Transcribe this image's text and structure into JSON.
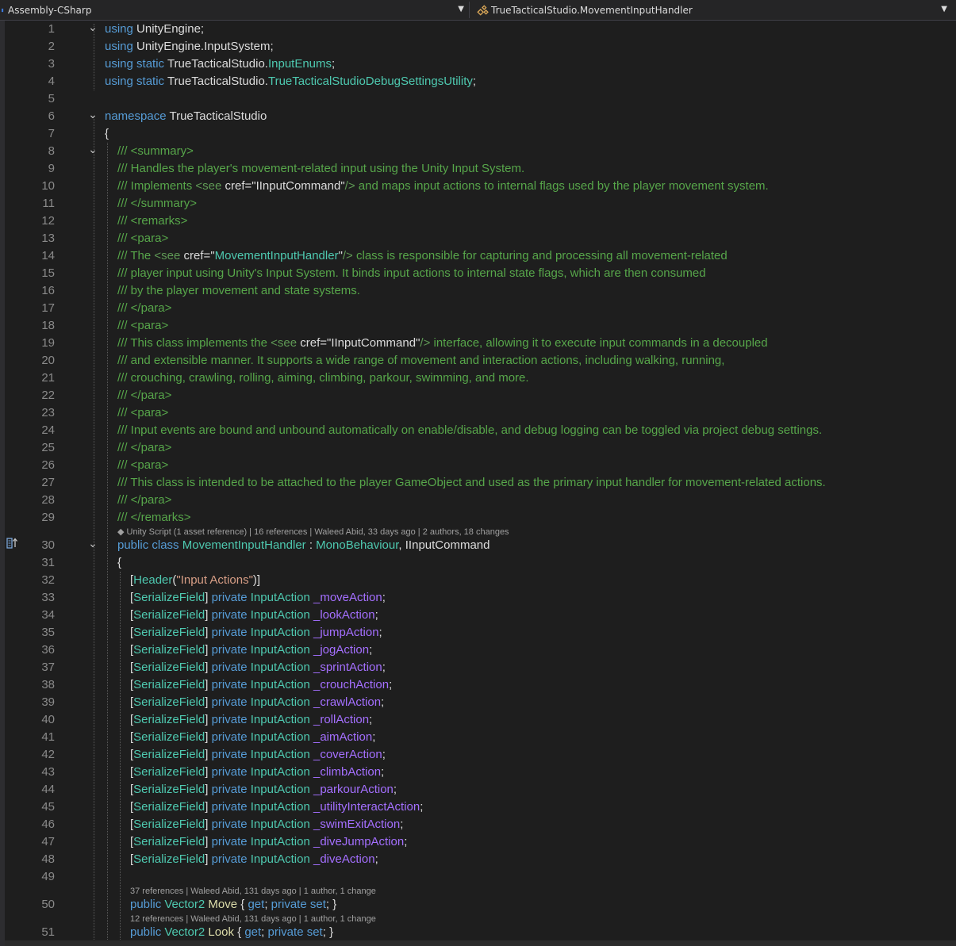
{
  "navbar": {
    "project": "Assembly-CSharp",
    "type_path": "TrueTacticalStudio.MovementInputHandler"
  },
  "colors": {
    "background": "#1e1e1e",
    "keyword": "#569cd6",
    "type": "#4ec9b0",
    "comment": "#57a64a",
    "string": "#d69d85",
    "field": "#a46fff",
    "text": "#dcdcdc",
    "line_number": "#8a8a8a"
  },
  "lines": [
    {
      "n": "1",
      "t": "using UnityEngine;"
    },
    {
      "n": "2",
      "t": "using UnityEngine.InputSystem;"
    },
    {
      "n": "3",
      "t": "using static TrueTacticalStudio.InputEnums;"
    },
    {
      "n": "4",
      "t": "using static TrueTacticalStudio.TrueTacticalStudioDebugSettingsUtility;"
    },
    {
      "n": "5",
      "t": ""
    },
    {
      "n": "6",
      "t": "namespace TrueTacticalStudio"
    },
    {
      "n": "7",
      "t": "{"
    },
    {
      "n": "8",
      "t": "/// <summary>"
    },
    {
      "n": "9",
      "t": "/// Handles the player's movement-related input using the Unity Input System."
    },
    {
      "n": "10",
      "t": "/// Implements <see cref=\"IInputCommand\"/> and maps input actions to internal flags used by the player movement system."
    },
    {
      "n": "11",
      "t": "/// </summary>"
    },
    {
      "n": "12",
      "t": "/// <remarks>"
    },
    {
      "n": "13",
      "t": "/// <para>"
    },
    {
      "n": "14",
      "t": "/// The <see cref=\"MovementInputHandler\"/> class is responsible for capturing and processing all movement-related"
    },
    {
      "n": "15",
      "t": "/// player input using Unity's Input System. It binds input actions to internal state flags, which are then consumed"
    },
    {
      "n": "16",
      "t": "/// by the player movement and state systems."
    },
    {
      "n": "17",
      "t": "/// </para>"
    },
    {
      "n": "18",
      "t": "/// <para>"
    },
    {
      "n": "19",
      "t": "/// This class implements the <see cref=\"IInputCommand\"/> interface, allowing it to execute input commands in a decoupled"
    },
    {
      "n": "20",
      "t": "/// and extensible manner. It supports a wide range of movement and interaction actions, including walking, running,"
    },
    {
      "n": "21",
      "t": "/// crouching, crawling, rolling, aiming, climbing, parkour, swimming, and more."
    },
    {
      "n": "22",
      "t": "/// </para>"
    },
    {
      "n": "23",
      "t": "/// <para>"
    },
    {
      "n": "24",
      "t": "/// Input events are bound and unbound automatically on enable/disable, and debug logging can be toggled via project debug settings."
    },
    {
      "n": "25",
      "t": "/// </para>"
    },
    {
      "n": "26",
      "t": "/// <para>"
    },
    {
      "n": "27",
      "t": "/// This class is intended to be attached to the player GameObject and used as the primary input handler for movement-related actions."
    },
    {
      "n": "28",
      "t": "/// </para>"
    },
    {
      "n": "29",
      "t": "/// </remarks>"
    },
    {
      "n": "30",
      "t": "public class MovementInputHandler : MonoBehaviour, IInputCommand"
    },
    {
      "n": "31",
      "t": "{"
    },
    {
      "n": "32",
      "t": "[Header(\"Input Actions\")]"
    },
    {
      "n": "33",
      "t": "[SerializeField] private InputAction _moveAction;"
    },
    {
      "n": "34",
      "t": "[SerializeField] private InputAction _lookAction;"
    },
    {
      "n": "35",
      "t": "[SerializeField] private InputAction _jumpAction;"
    },
    {
      "n": "36",
      "t": "[SerializeField] private InputAction _jogAction;"
    },
    {
      "n": "37",
      "t": "[SerializeField] private InputAction _sprintAction;"
    },
    {
      "n": "38",
      "t": "[SerializeField] private InputAction _crouchAction;"
    },
    {
      "n": "39",
      "t": "[SerializeField] private InputAction _crawlAction;"
    },
    {
      "n": "40",
      "t": "[SerializeField] private InputAction _rollAction;"
    },
    {
      "n": "41",
      "t": "[SerializeField] private InputAction _aimAction;"
    },
    {
      "n": "42",
      "t": "[SerializeField] private InputAction _coverAction;"
    },
    {
      "n": "43",
      "t": "[SerializeField] private InputAction _climbAction;"
    },
    {
      "n": "44",
      "t": "[SerializeField] private InputAction _parkourAction;"
    },
    {
      "n": "45",
      "t": "[SerializeField] private InputAction _utilityInteractAction;"
    },
    {
      "n": "46",
      "t": "[SerializeField] private InputAction _swimExitAction;"
    },
    {
      "n": "47",
      "t": "[SerializeField] private InputAction _diveJumpAction;"
    },
    {
      "n": "48",
      "t": "[SerializeField] private InputAction _diveAction;"
    },
    {
      "n": "49",
      "t": ""
    },
    {
      "n": "50",
      "t": "public Vector2 Move { get; private set; }"
    },
    {
      "n": "51",
      "t": "public Vector2 Look { get; private set; }"
    }
  ],
  "codelens": {
    "class_info": "Unity Script (1 asset reference) | 16 references | Waleed Abid, 33 days ago | 2 authors, 18 changes",
    "move_info": "37 references | Waleed Abid, 131 days ago | 1 author, 1 change",
    "look_info": "12 references | Waleed Abid, 131 days ago | 1 author, 1 change"
  }
}
